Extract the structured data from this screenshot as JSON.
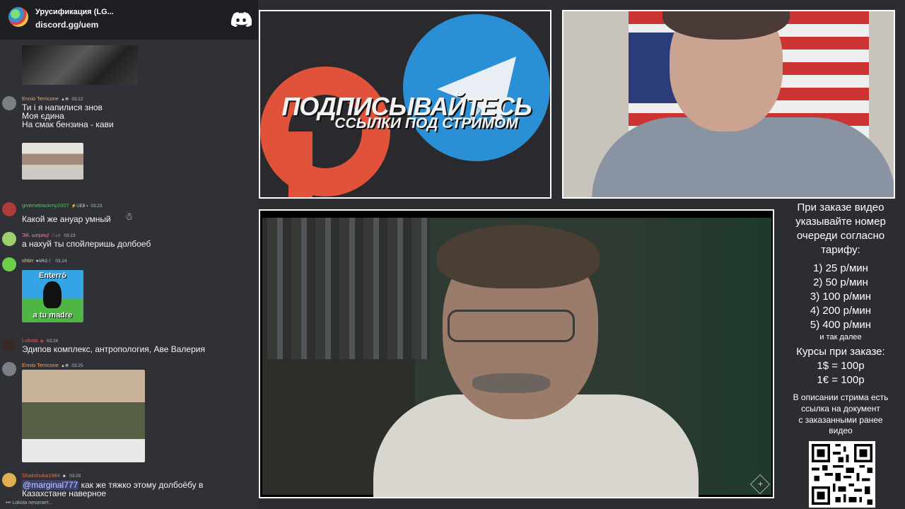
{
  "chat": {
    "server_name": "Урусификация (LG...",
    "invite": "discord.gg/uem",
    "messages": [
      {
        "user": "Ennio Terricone",
        "badge": "",
        "time": "03:22",
        "lines": [
          "Ти і я напилися знов",
          "Моя єдина",
          "На смак бензина - кави"
        ]
      },
      {
        "user": "givemebackmy2007",
        "badge": "UEB",
        "time": "03:23",
        "lines": [
          "Какой же ануар умный"
        ]
      },
      {
        "user": "Эй, шприц!",
        "badge": "",
        "time": "03:23",
        "lines": [
          "а нахуй ты спойлеришь долбоеб"
        ]
      },
      {
        "user": "shtirr",
        "badge": "ARG",
        "time": "03:24",
        "image_caption_top": "Enterrō",
        "image_caption_bottom": "a tu madre"
      },
      {
        "user": "Lokota",
        "badge": "",
        "time": "03:24",
        "lines": [
          "Эдипов комплекс, антропология, Аве Валерия"
        ]
      },
      {
        "user": "Ennio Terricone",
        "badge": "",
        "time": "03:25",
        "lines": []
      },
      {
        "user": "Shakshuka1984",
        "badge": "",
        "time": "03:25",
        "mention": "@marginal777",
        "lines": [
          "как же тяжко этому долбоёбу в",
          "Казахстане наверное"
        ]
      }
    ],
    "typing": "Lokota печатает..."
  },
  "promo": {
    "title": "ПОДПИСЫВАЙТЕСЬ",
    "subtitle": "ССЫЛКИ ПОД СТРИМОМ"
  },
  "info": {
    "header": [
      "При заказе видео",
      "указывайте номер",
      "очереди согласно",
      "тарифу:"
    ],
    "tiers": [
      "1) 25 р/мин",
      "2) 50 р/мин",
      "3) 100 р/мин",
      "4) 200 р/мин",
      "5) 400 р/мин"
    ],
    "etc": "и так далее",
    "rates_title": "Курсы при заказе:",
    "rates": [
      "1$ = 100р",
      "1€ = 100р"
    ],
    "footer": [
      "В описании стрима есть",
      "ссылка на документ",
      "с заказанными ранее",
      "видео"
    ]
  },
  "colors": {
    "chat_bg": "#2f3136",
    "header_bg": "#1e1f22",
    "username_orange": "#f0a35b",
    "username_green": "#5fbf6a",
    "mention_bg": "#3c4270"
  }
}
